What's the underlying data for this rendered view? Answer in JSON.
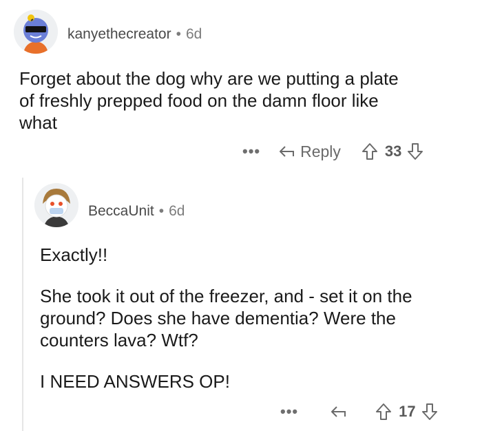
{
  "comments": [
    {
      "author": "kanyethecreator",
      "separator": "•",
      "age": "6d",
      "body_lines": [
        "Forget about the dog why are we putting a plate",
        "of freshly prepped food on the damn floor like",
        "what"
      ],
      "more_label": "•••",
      "reply_label": "Reply",
      "votes": "33"
    },
    {
      "author": "BeccaUnit",
      "separator": "•",
      "age": "6d",
      "paragraphs": [
        [
          "Exactly!!"
        ],
        [
          "She took it out of the freezer, and - set it on the",
          "ground? Does she have dementia? Were the",
          "counters lava? Wtf?"
        ],
        [
          "I NEED ANSWERS OP!"
        ]
      ],
      "more_label": "•••",
      "votes": "17"
    }
  ]
}
